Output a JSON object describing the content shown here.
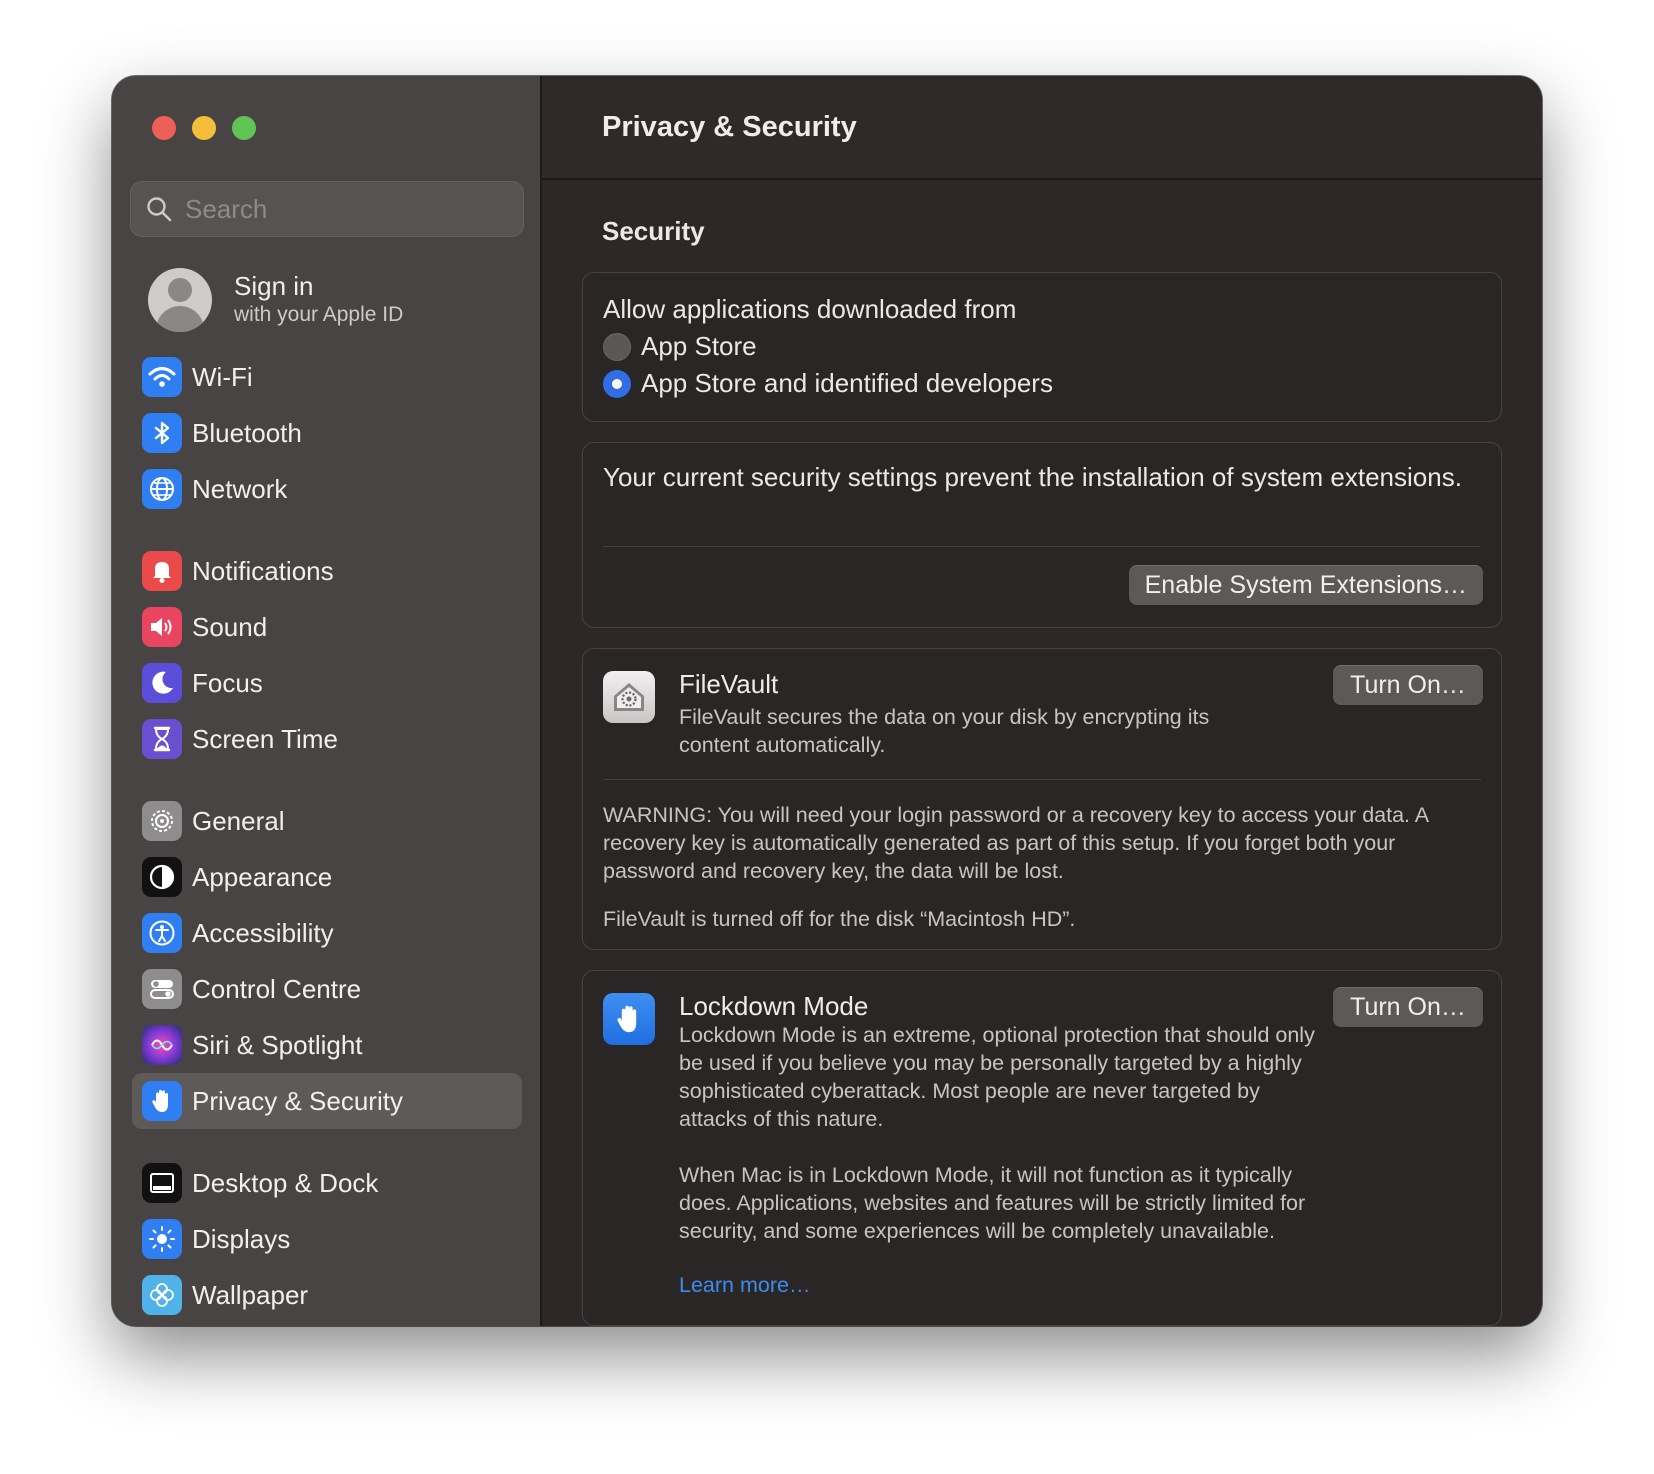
{
  "sidebar": {
    "search_placeholder": "Search",
    "account": {
      "title": "Sign in",
      "subtitle": "with your Apple ID"
    },
    "items": [
      {
        "label": "Wi-Fi",
        "icon": "wifi-icon",
        "color": "#2f7ff2"
      },
      {
        "label": "Bluetooth",
        "icon": "bluetooth-icon",
        "color": "#2f7ff2"
      },
      {
        "label": "Network",
        "icon": "globe-icon",
        "color": "#2f7ff2"
      },
      {
        "label": "Notifications",
        "icon": "bell-icon",
        "color": "#ea4a4a"
      },
      {
        "label": "Sound",
        "icon": "speaker-icon",
        "color": "#ea4560"
      },
      {
        "label": "Focus",
        "icon": "moon-icon",
        "color": "#5b4fd9"
      },
      {
        "label": "Screen Time",
        "icon": "hourglass-icon",
        "color": "#6a4fd1"
      },
      {
        "label": "General",
        "icon": "gear-icon",
        "color": "#8e8c8c"
      },
      {
        "label": "Appearance",
        "icon": "appearance-icon",
        "color": "#111111"
      },
      {
        "label": "Accessibility",
        "icon": "accessibility-icon",
        "color": "#2f7ff2"
      },
      {
        "label": "Control Centre",
        "icon": "toggles-icon",
        "color": "#8e8c8c"
      },
      {
        "label": "Siri & Spotlight",
        "icon": "siri-icon",
        "color": "#6b3fd6"
      },
      {
        "label": "Privacy & Security",
        "icon": "hand-icon",
        "color": "#2f7ff2",
        "selected": true
      },
      {
        "label": "Desktop & Dock",
        "icon": "dock-icon",
        "color": "#111111"
      },
      {
        "label": "Displays",
        "icon": "sun-icon",
        "color": "#2f7ff2"
      },
      {
        "label": "Wallpaper",
        "icon": "flower-icon",
        "color": "#4fb2e8"
      }
    ]
  },
  "main": {
    "title": "Privacy & Security",
    "section_title": "Security",
    "allow": {
      "title": "Allow applications downloaded from",
      "options": [
        {
          "label": "App Store",
          "selected": false
        },
        {
          "label": "App Store and identified developers",
          "selected": true
        }
      ]
    },
    "extensions": {
      "text": "Your current security settings prevent the installation of system extensions.",
      "button": "Enable System Extensions…"
    },
    "filevault": {
      "title": "FileVault",
      "description": "FileVault secures the data on your disk by encrypting its content automatically.",
      "button": "Turn On…",
      "warning": "WARNING: You will need your login password or a recovery key to access your data. A recovery key is automatically generated as part of this setup. If you forget both your password and recovery key, the data will be lost.",
      "status": "FileVault is turned off for the disk “Macintosh HD”."
    },
    "lockdown": {
      "title": "Lockdown Mode",
      "description": "Lockdown Mode is an extreme, optional protection that should only be used if you believe you may be personally targeted by a highly sophisticated cyberattack. Most people are never targeted by attacks of this nature.",
      "description2": "When Mac is in Lockdown Mode, it will not function as it typically does. Applications, websites and features will be strictly limited for security, and some experiences will be completely unavailable.",
      "link": "Learn more…",
      "button": "Turn On…"
    }
  }
}
